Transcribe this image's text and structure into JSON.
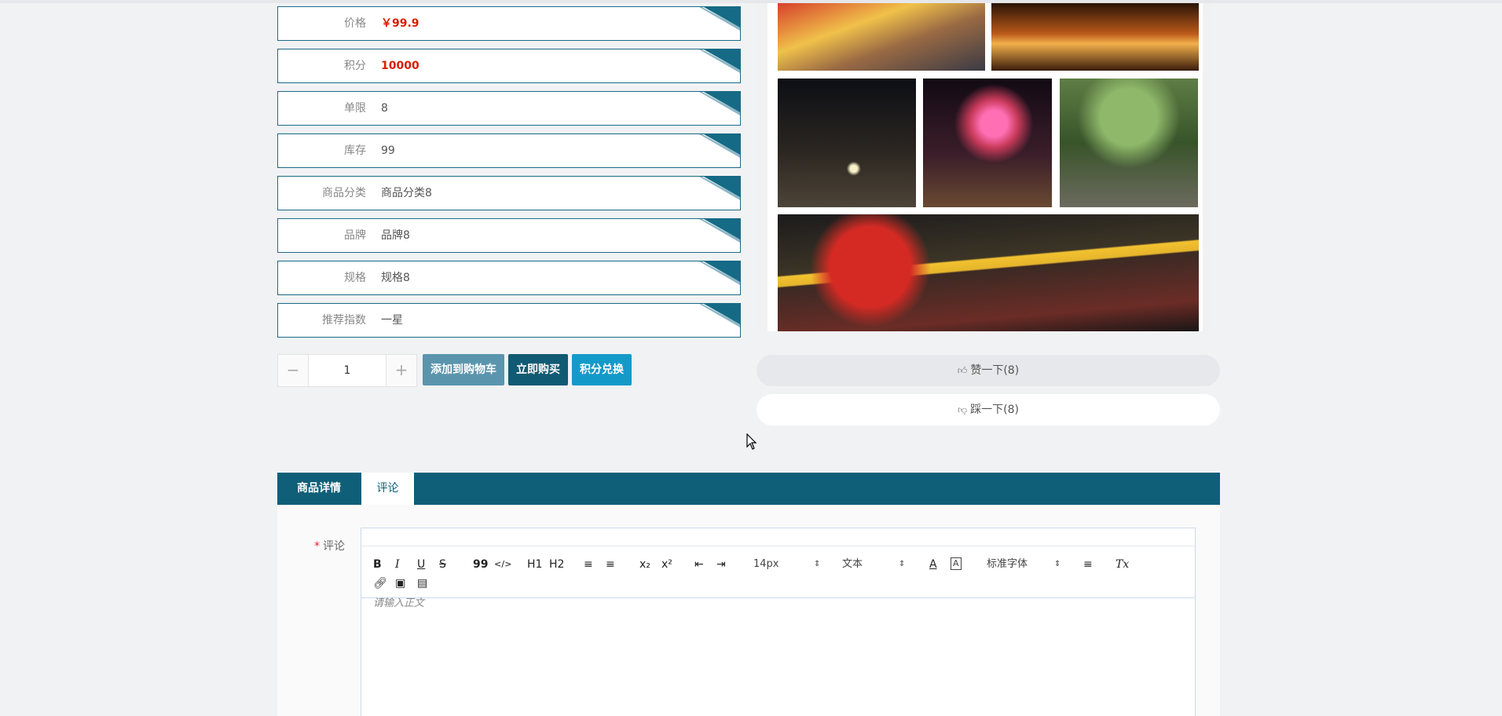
{
  "product_info": [
    {
      "label": "价格",
      "value": "￥99.9",
      "highlight": true
    },
    {
      "label": "积分",
      "value": "10000",
      "highlight": true
    },
    {
      "label": "单限",
      "value": "8",
      "highlight": false
    },
    {
      "label": "库存",
      "value": "99",
      "highlight": false
    },
    {
      "label": "商品分类",
      "value": "商品分类8",
      "highlight": false
    },
    {
      "label": "品牌",
      "value": "品牌8",
      "highlight": false
    },
    {
      "label": "规格",
      "value": "规格8",
      "highlight": false
    },
    {
      "label": "推荐指数",
      "value": "一星",
      "highlight": false
    }
  ],
  "quantity": {
    "minus": "−",
    "value": "1",
    "plus": "+"
  },
  "actions": {
    "add_to_cart": "添加到购物车",
    "buy_now": "立即购买",
    "points_exchange": "积分兑换"
  },
  "votes": {
    "like": "赞一下(8)",
    "dislike": "踩一下(8)"
  },
  "tabs": [
    {
      "label": "商品详情",
      "active": false
    },
    {
      "label": "评论",
      "active": true
    }
  ],
  "comment_form": {
    "label": "评论",
    "required_mark": "*",
    "placeholder": "请输入正文",
    "toolbar": {
      "bold": "B",
      "italic": "I",
      "underline": "U",
      "strike": "S",
      "blockquote": "99",
      "code": "</>",
      "h1": "H1",
      "h2": "H2",
      "ordered_list": "≡",
      "bullet_list": "≡",
      "subscript": "x₂",
      "superscript": "x²",
      "outdent": "⇤",
      "indent": "⇥",
      "font_size": "14px",
      "header_type": "文本",
      "font_family": "标准字体",
      "align": "≡",
      "clear": "Tx"
    }
  },
  "colors": {
    "accent": "#0f5f78",
    "price_red": "#d81e06",
    "points_button": "#149ac9"
  }
}
